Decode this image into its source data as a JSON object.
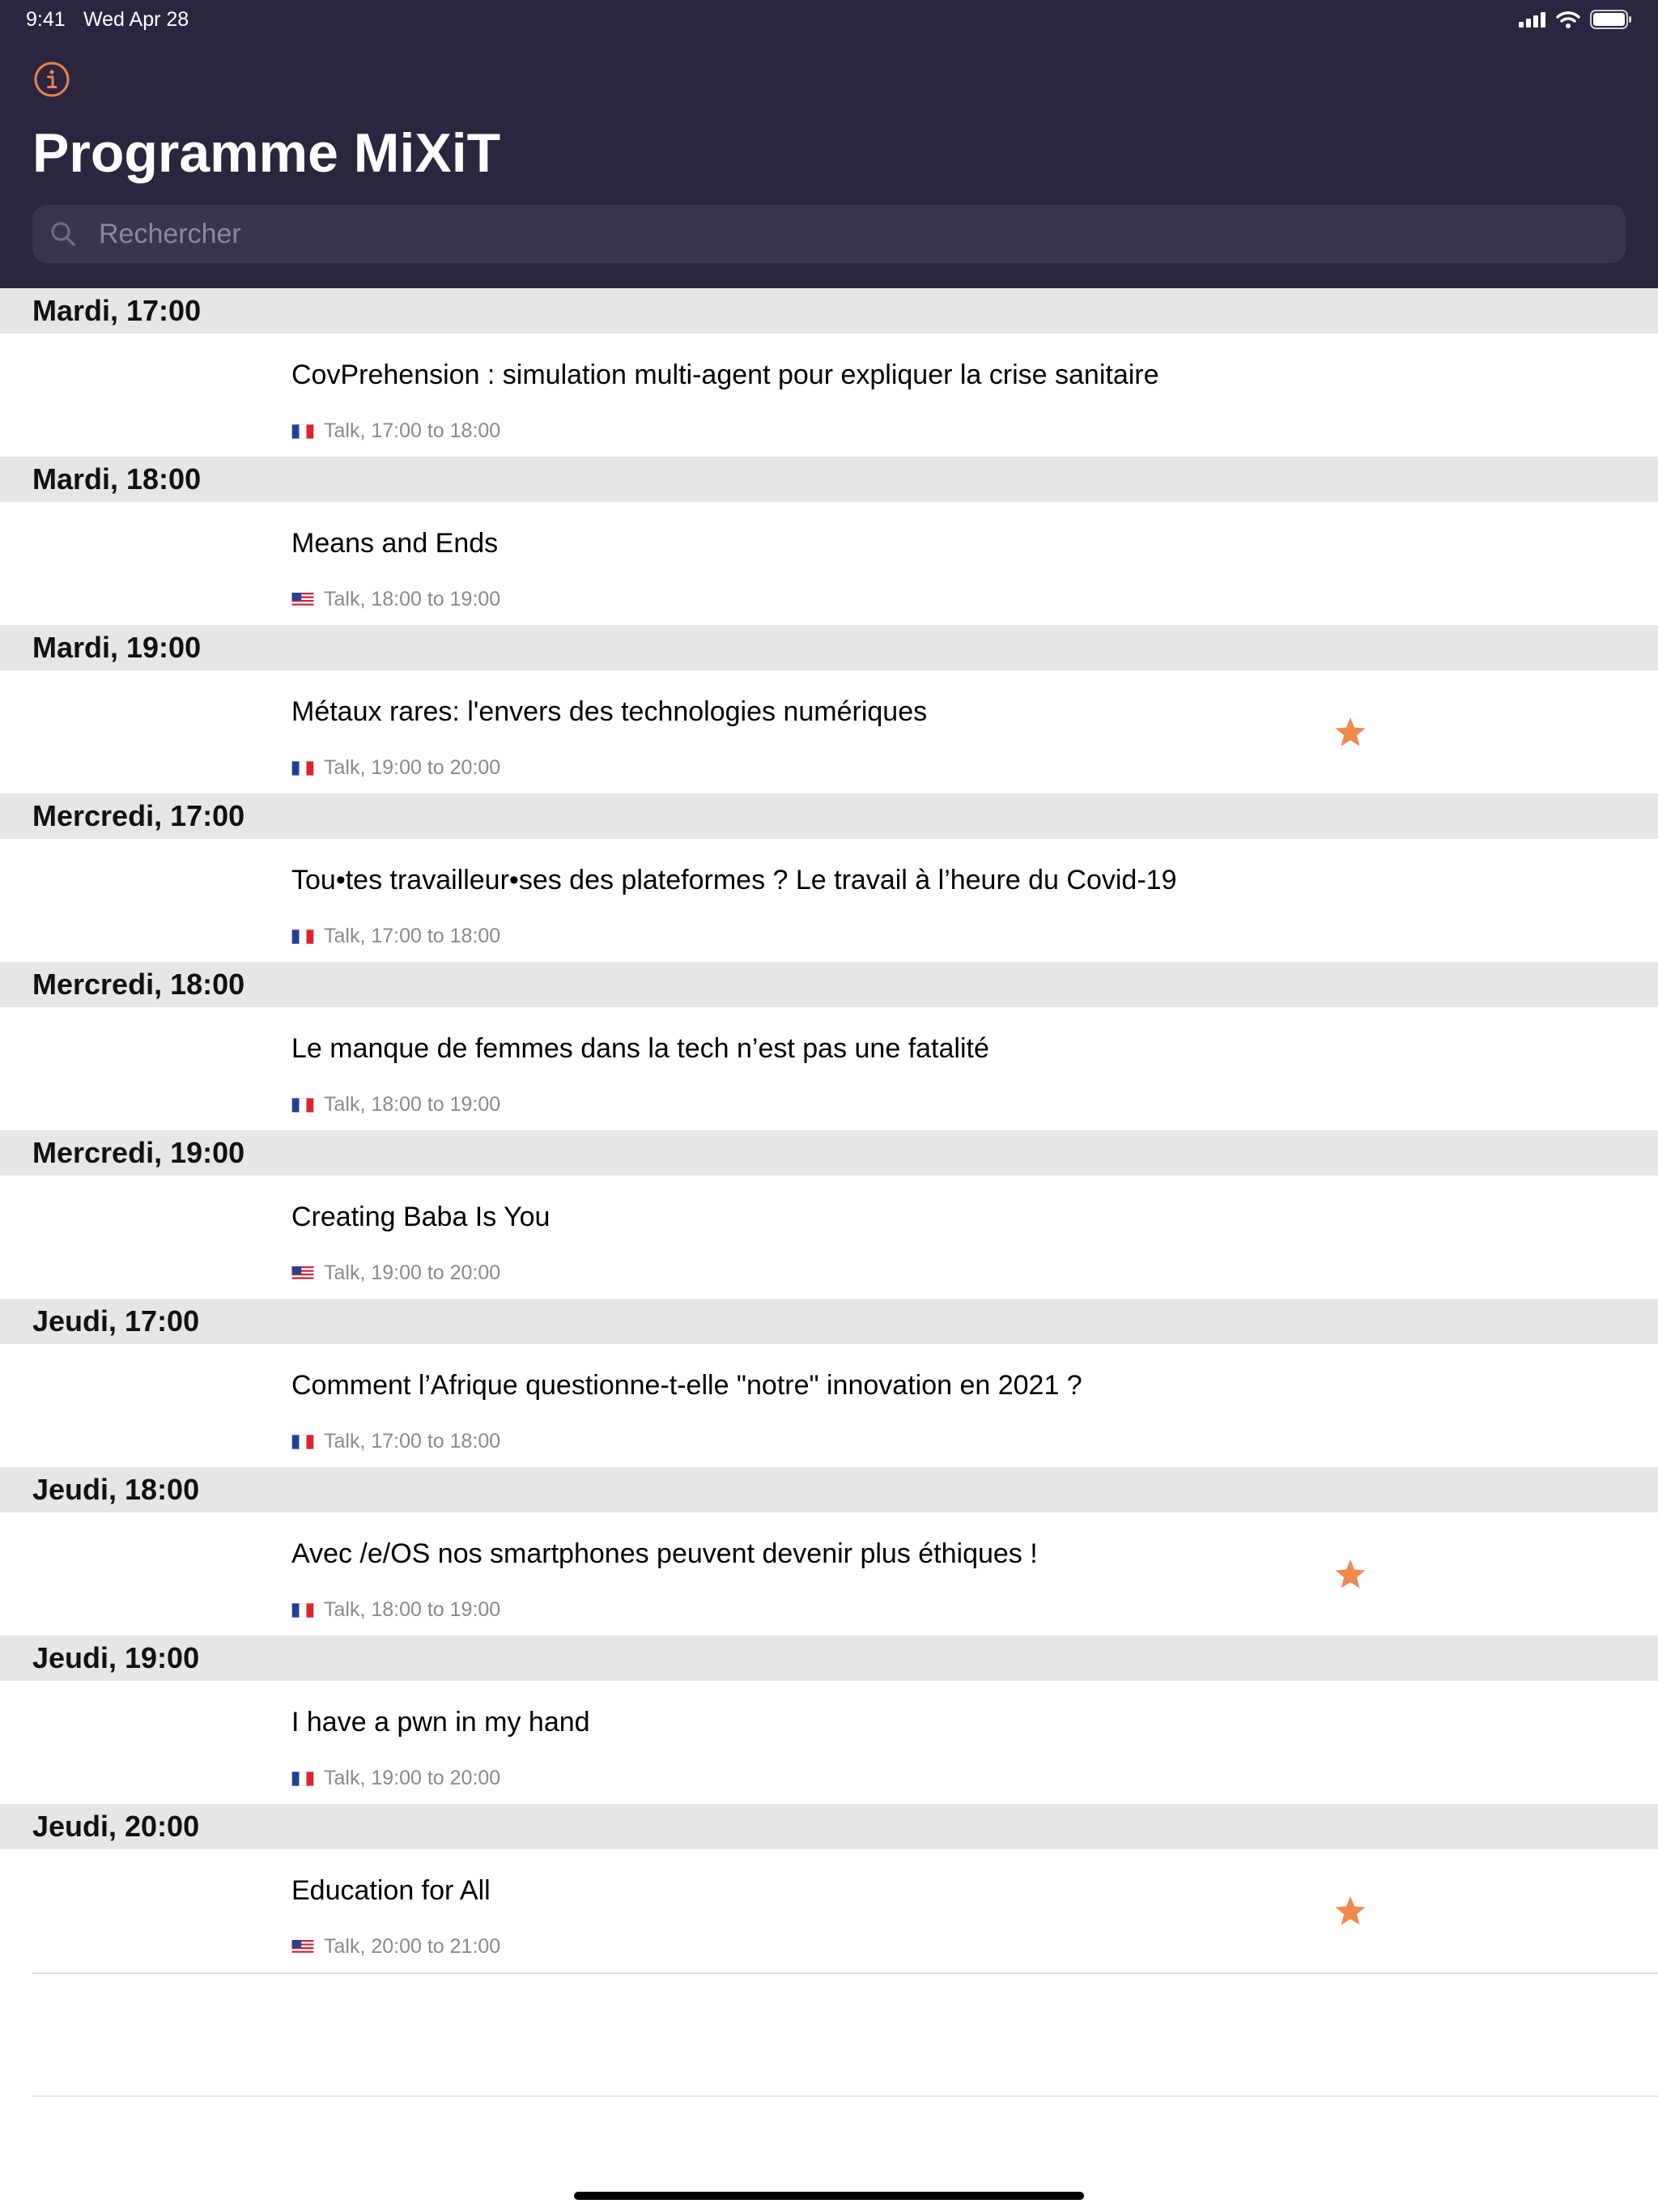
{
  "status_bar": {
    "time": "9:41",
    "date": "Wed Apr 28"
  },
  "header": {
    "title": "Programme MiXiT",
    "search_placeholder": "Rechercher",
    "accent_color": "#e8844e",
    "background_color": "#2c2540"
  },
  "sections": [
    {
      "title": "Mardi, 17:00",
      "sessions": [
        {
          "title": "CovPrehension : simulation multi-agent pour expliquer la crise sanitaire",
          "lang": "fr",
          "meta": "Talk, 17:00 to 18:00",
          "favorite": false
        }
      ]
    },
    {
      "title": "Mardi, 18:00",
      "sessions": [
        {
          "title": "Means and Ends",
          "lang": "en",
          "meta": "Talk, 18:00 to 19:00",
          "favorite": false
        }
      ]
    },
    {
      "title": "Mardi, 19:00",
      "sessions": [
        {
          "title": "Métaux rares: l'envers des technologies numériques",
          "lang": "fr",
          "meta": "Talk, 19:00 to 20:00",
          "favorite": true
        }
      ]
    },
    {
      "title": "Mercredi, 17:00",
      "sessions": [
        {
          "title": "Tou•tes travailleur•ses des plateformes ? Le travail à l’heure du Covid-19",
          "lang": "fr",
          "meta": "Talk, 17:00 to 18:00",
          "favorite": false
        }
      ]
    },
    {
      "title": "Mercredi, 18:00",
      "sessions": [
        {
          "title": "Le manque de femmes dans la tech n’est pas une fatalité",
          "lang": "fr",
          "meta": "Talk, 18:00 to 19:00",
          "favorite": false
        }
      ]
    },
    {
      "title": "Mercredi, 19:00",
      "sessions": [
        {
          "title": "Creating Baba Is You",
          "lang": "en",
          "meta": "Talk, 19:00 to 20:00",
          "favorite": false
        }
      ]
    },
    {
      "title": "Jeudi, 17:00",
      "sessions": [
        {
          "title": "Comment l’Afrique questionne-t-elle \"notre\" innovation en 2021 ?",
          "lang": "fr",
          "meta": "Talk, 17:00 to 18:00",
          "favorite": false
        }
      ]
    },
    {
      "title": "Jeudi, 18:00",
      "sessions": [
        {
          "title": "Avec /e/OS nos smartphones peuvent devenir plus éthiques !",
          "lang": "fr",
          "meta": "Talk, 18:00 to 19:00",
          "favorite": true
        }
      ]
    },
    {
      "title": "Jeudi, 19:00",
      "sessions": [
        {
          "title": "I have a pwn in my hand",
          "lang": "fr",
          "meta": "Talk, 19:00 to 20:00",
          "favorite": false
        }
      ]
    },
    {
      "title": "Jeudi, 20:00",
      "sessions": [
        {
          "title": "Education for All",
          "lang": "en",
          "meta": "Talk, 20:00 to 21:00",
          "favorite": true
        }
      ]
    }
  ]
}
